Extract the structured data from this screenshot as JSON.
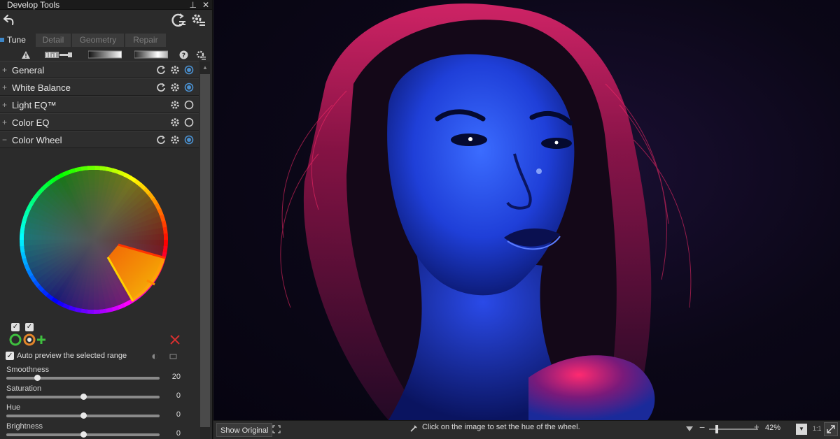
{
  "panel": {
    "title": "Develop Tools",
    "tabs": [
      {
        "label": "Tune",
        "active": true
      },
      {
        "label": "Detail",
        "active": false
      },
      {
        "label": "Geometry",
        "active": false
      },
      {
        "label": "Repair",
        "active": false
      }
    ],
    "sections": [
      {
        "label": "General",
        "expanded": false
      },
      {
        "label": "White Balance",
        "expanded": false
      },
      {
        "label": "Light EQ™",
        "expanded": false
      },
      {
        "label": "Color EQ",
        "expanded": false
      },
      {
        "label": "Color Wheel",
        "expanded": true
      }
    ],
    "auto_preview_label": "Auto preview the selected range",
    "sliders": [
      {
        "label": "Smoothness",
        "value": "20",
        "fraction": 0.2
      },
      {
        "label": "Saturation",
        "value": "0",
        "fraction": 0.5
      },
      {
        "label": "Hue",
        "value": "0",
        "fraction": 0.5
      },
      {
        "label": "Brightness",
        "value": "0",
        "fraction": 0.5
      }
    ]
  },
  "bottombar": {
    "show_original": "Show Original",
    "hint": "Click on the image to set the hue of the wheel.",
    "zoom": "42%",
    "one_to_one": "1:1"
  },
  "colors": {
    "accent": "#3d87c9",
    "panel_bg": "#2b2b2b",
    "remove_red": "#d83030",
    "add_green": "#3fbf3f"
  }
}
